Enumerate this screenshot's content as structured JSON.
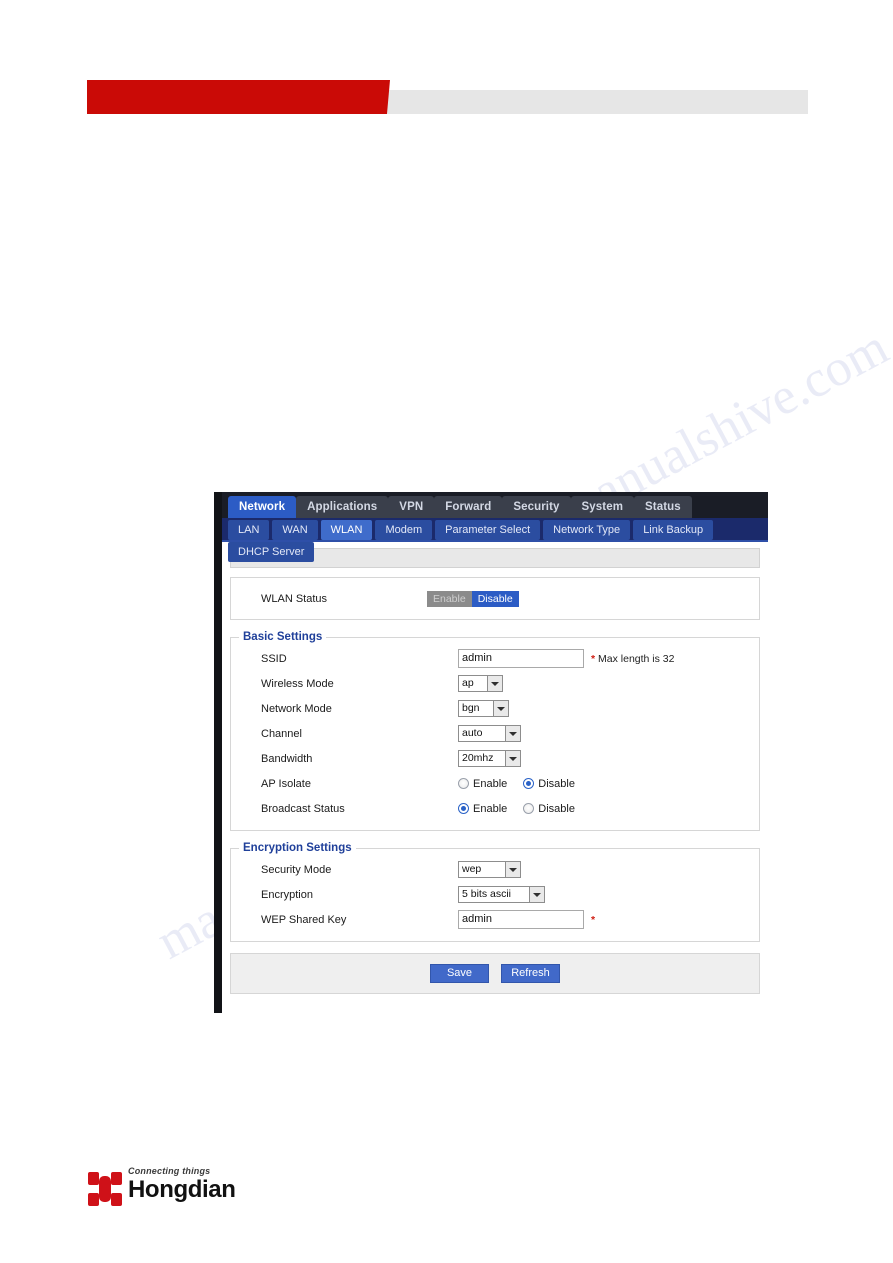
{
  "document": {
    "watermark_text": "manualshive.com"
  },
  "nav": {
    "main_tabs": [
      {
        "label": "Network",
        "active": true
      },
      {
        "label": "Applications",
        "active": false
      },
      {
        "label": "VPN",
        "active": false
      },
      {
        "label": "Forward",
        "active": false
      },
      {
        "label": "Security",
        "active": false
      },
      {
        "label": "System",
        "active": false
      },
      {
        "label": "Status",
        "active": false
      }
    ],
    "sub_tabs": [
      {
        "label": "LAN",
        "active": false
      },
      {
        "label": "WAN",
        "active": false
      },
      {
        "label": "WLAN",
        "active": true
      },
      {
        "label": "Modem",
        "active": false
      },
      {
        "label": "Parameter Select",
        "active": false
      },
      {
        "label": "Network Type",
        "active": false
      },
      {
        "label": "Link Backup",
        "active": false
      },
      {
        "label": "DHCP Server",
        "active": false
      }
    ]
  },
  "wlan_status": {
    "label": "WLAN Status",
    "enable_label": "Enable",
    "disable_label": "Disable",
    "selected": "Disable"
  },
  "basic_settings": {
    "legend": "Basic Settings",
    "ssid": {
      "label": "SSID",
      "value": "admin",
      "placeholder": "",
      "star": "*",
      "hint": "Max length is 32"
    },
    "wireless_mode": {
      "label": "Wireless Mode",
      "value": "ap"
    },
    "network_mode": {
      "label": "Network Mode",
      "value": "bgn"
    },
    "channel": {
      "label": "Channel",
      "value": "auto"
    },
    "bandwidth": {
      "label": "Bandwidth",
      "value": "20mhz"
    },
    "ap_isolate": {
      "label": "AP Isolate",
      "enable_label": "Enable",
      "disable_label": "Disable",
      "selected": "Disable"
    },
    "broadcast_status": {
      "label": "Broadcast Status",
      "enable_label": "Enable",
      "disable_label": "Disable",
      "selected": "Enable"
    }
  },
  "encryption_settings": {
    "legend": "Encryption Settings",
    "security_mode": {
      "label": "Security Mode",
      "value": "wep"
    },
    "encryption": {
      "label": "Encryption",
      "value": "5 bits ascii"
    },
    "wep_shared_key": {
      "label": "WEP Shared Key",
      "value": "admin",
      "placeholder": "",
      "star": "*"
    }
  },
  "actions": {
    "save_label": "Save",
    "refresh_label": "Refresh"
  },
  "footer": {
    "logo_tagline": "Connecting things",
    "logo_name": "Hongdian"
  },
  "colors": {
    "brand_red": "#ca0a06",
    "nav_blue": "#2c5cc5",
    "subnav_blue": "#1b2a6b",
    "button_blue": "#4169c9",
    "legend_blue": "#20409a",
    "required_red": "#d01e14"
  }
}
